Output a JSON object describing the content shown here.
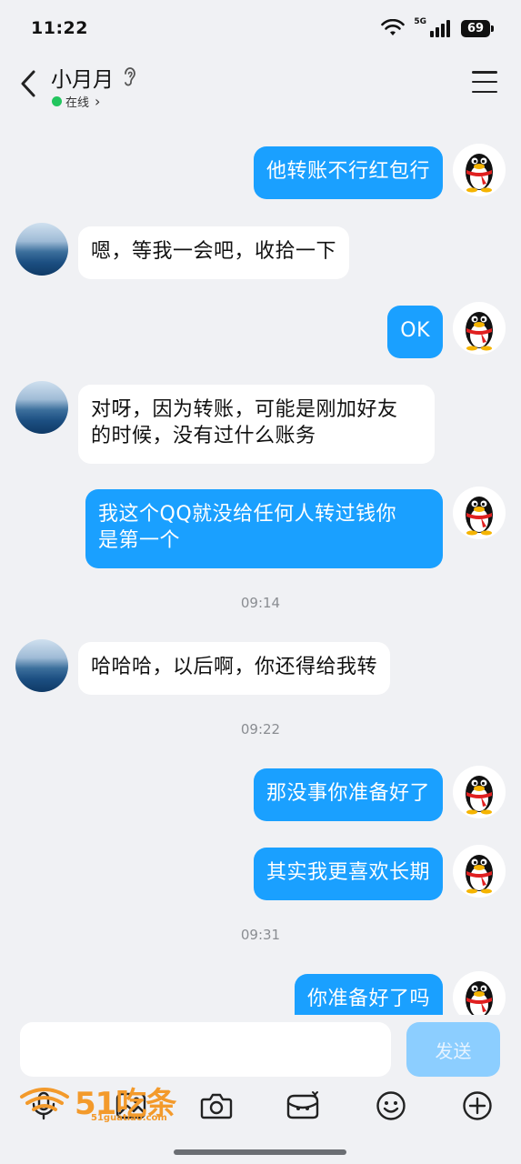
{
  "status_bar": {
    "time": "11:22",
    "network": "5G",
    "battery": "69"
  },
  "header": {
    "contact_name": "小月月",
    "status": "在线",
    "status_chevron": "›"
  },
  "messages": [
    {
      "from": "self",
      "text": "他转账不行红包行"
    },
    {
      "from": "other",
      "text": "嗯，等我一会吧，收拾一下"
    },
    {
      "from": "self",
      "text": "OK"
    },
    {
      "from": "other",
      "text_lines": [
        "对呀，因为转账，可能是刚加好友",
        "的时候，没有过什么账务"
      ]
    },
    {
      "from": "self",
      "text_lines": [
        "我这个QQ就没给任何人转过钱你",
        "是第一个"
      ]
    },
    {
      "timestamp": "09:14"
    },
    {
      "from": "other",
      "text": "哈哈哈，以后啊，你还得给我转"
    },
    {
      "timestamp": "09:22"
    },
    {
      "from": "self",
      "text": "那没事你准备好了"
    },
    {
      "from": "self",
      "text": "其实我更喜欢长期"
    },
    {
      "timestamp": "09:31"
    },
    {
      "from": "self",
      "text": "你准备好了吗"
    }
  ],
  "input": {
    "placeholder": "",
    "send_label": "发送"
  },
  "toolbar": {
    "icons": [
      "voice-icon",
      "image-icon",
      "camera-icon",
      "red-packet-icon",
      "emoji-icon",
      "plus-icon"
    ]
  },
  "watermark": {
    "brand": "51吃条",
    "url": "51guatiao.com"
  },
  "colors": {
    "outgoing_bubble": "#1aa0ff",
    "incoming_bubble": "#ffffff",
    "send_button": "#8cceff",
    "background": "#f0f1f4",
    "online": "#22c55e"
  }
}
